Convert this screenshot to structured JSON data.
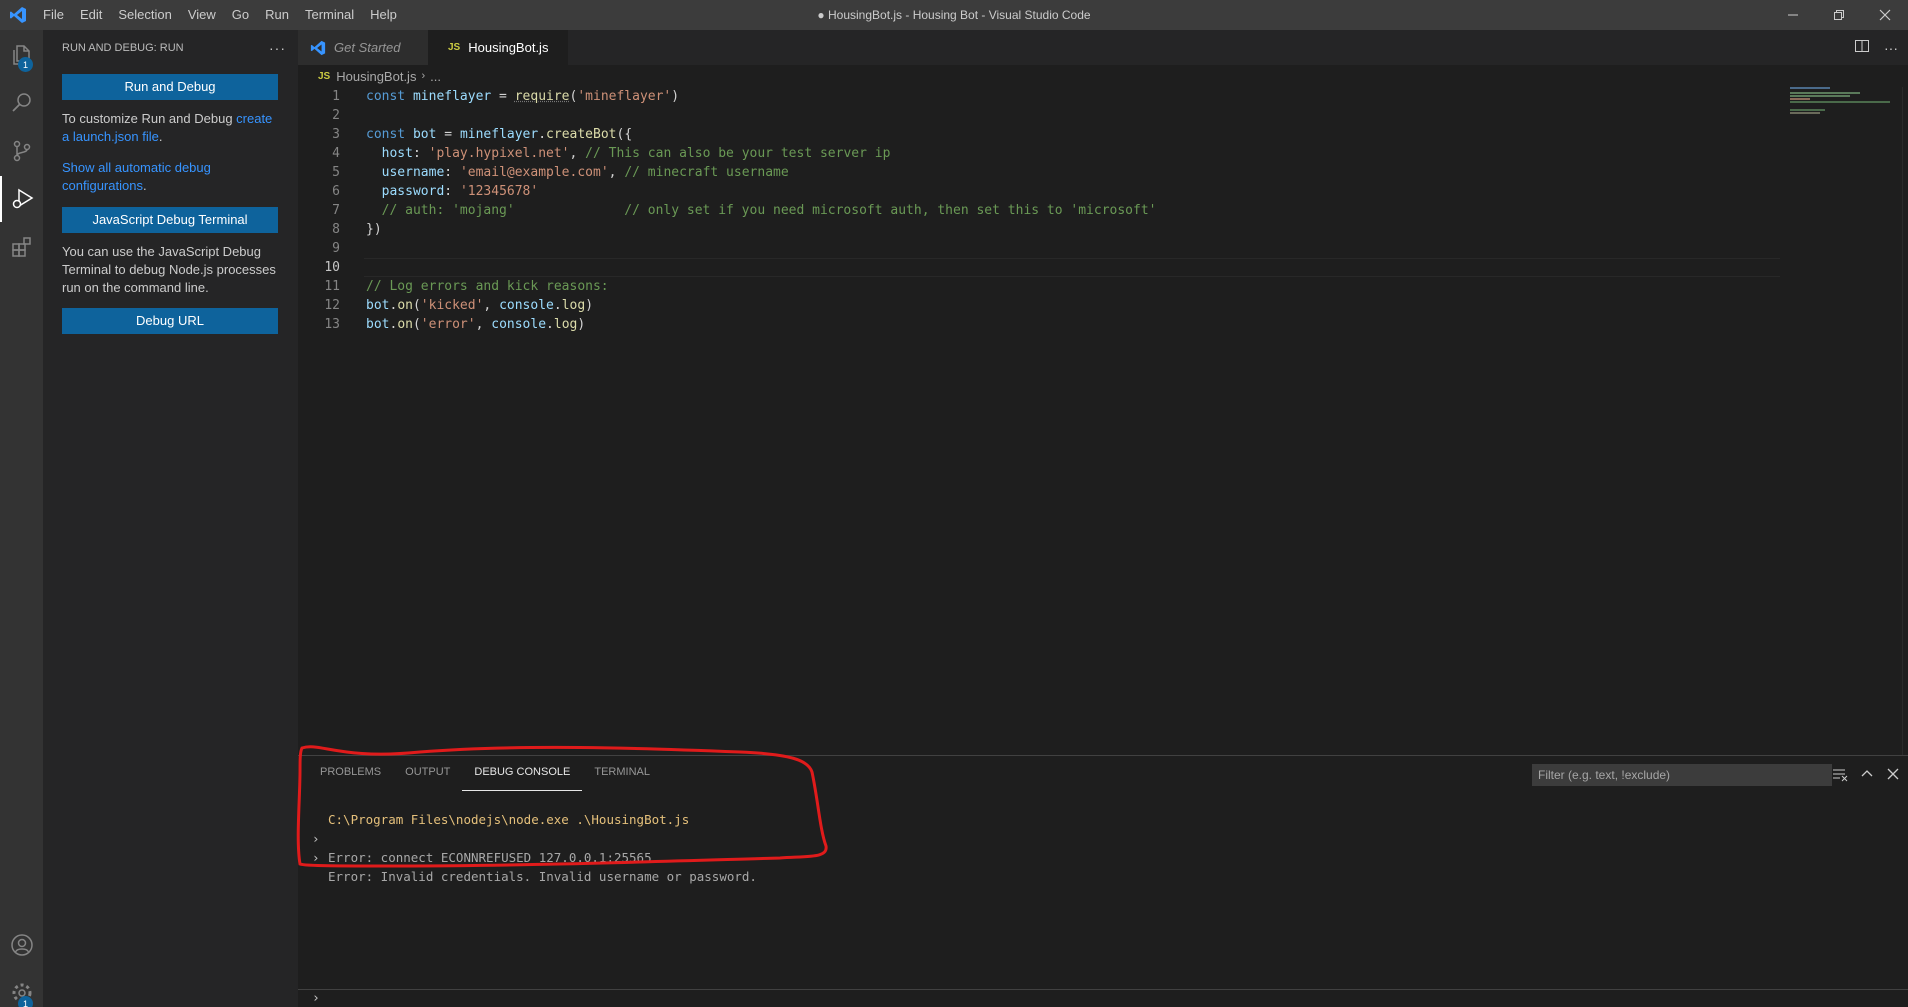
{
  "window": {
    "title": "● HousingBot.js - Housing Bot - Visual Studio Code",
    "menu": [
      "File",
      "Edit",
      "Selection",
      "View",
      "Go",
      "Run",
      "Terminal",
      "Help"
    ]
  },
  "activity_bar": {
    "explorer_badge": "1",
    "settings_badge": "1"
  },
  "sidebar": {
    "header": "RUN AND DEBUG: RUN",
    "run_button": "Run and Debug",
    "customize_text": "To customize Run and Debug ",
    "create_link": "create a launch.json file",
    "customize_end": ".",
    "show_link": "Show all automatic debug configurations",
    "show_end": ".",
    "js_terminal_button": "JavaScript Debug Terminal",
    "js_terminal_text": "You can use the JavaScript Debug Terminal to debug Node.js processes run on the command line.",
    "debug_url_button": "Debug URL"
  },
  "tabs": [
    {
      "label": "Get Started",
      "active": false
    },
    {
      "label": "HousingBot.js",
      "active": true,
      "modified": true
    }
  ],
  "breadcrumb": {
    "icon": "JS",
    "file": "HousingBot.js",
    "rest": "..."
  },
  "editor": {
    "current_line": 10,
    "lines": [
      {
        "n": "1"
      },
      {
        "n": "2"
      },
      {
        "n": "3"
      },
      {
        "n": "4"
      },
      {
        "n": "5"
      },
      {
        "n": "6"
      },
      {
        "n": "7"
      },
      {
        "n": "8"
      },
      {
        "n": "9"
      },
      {
        "n": "10"
      },
      {
        "n": "11"
      },
      {
        "n": "12"
      },
      {
        "n": "13"
      }
    ],
    "code": {
      "l1": [
        "const",
        " mineflayer",
        " = ",
        "require",
        "(",
        "'mineflayer'",
        ")"
      ],
      "l3": [
        "const",
        " bot",
        " = ",
        "mineflayer",
        ".",
        "createBot",
        "({"
      ],
      "l4": [
        "  host",
        ": ",
        "'play.hypixel.net'",
        ", ",
        "// This can also be your test server ip"
      ],
      "l5": [
        "  username",
        ": ",
        "'email@example.com'",
        ", ",
        "// minecraft username"
      ],
      "l6": [
        "  password",
        ": ",
        "'12345678'"
      ],
      "l7": [
        "  // auth: 'mojang'              // only set if you need microsoft auth, then set this to 'microsoft'"
      ],
      "l8": [
        "})"
      ],
      "l11": [
        "// Log errors and kick reasons:"
      ],
      "l12": [
        "bot",
        ".",
        "on",
        "(",
        "'kicked'",
        ", ",
        "console",
        ".",
        "log",
        ")"
      ],
      "l13": [
        "bot",
        ".",
        "on",
        "(",
        "'error'",
        ", ",
        "console",
        ".",
        "log",
        ")"
      ]
    }
  },
  "panel": {
    "tabs": [
      "PROBLEMS",
      "OUTPUT",
      "DEBUG CONSOLE",
      "TERMINAL"
    ],
    "active_tab": "DEBUG CONSOLE",
    "filter_placeholder": "Filter (e.g. text, !exclude)",
    "console": {
      "command": "C:\\Program Files\\nodejs\\node.exe .\\HousingBot.js",
      "errors": [
        "Error: connect ECONNREFUSED 127.0.0.1:25565",
        "Error: Invalid credentials. Invalid username or password."
      ]
    }
  },
  "colors": {
    "accent": "#0e639c",
    "annotation": "#e01b1b"
  }
}
